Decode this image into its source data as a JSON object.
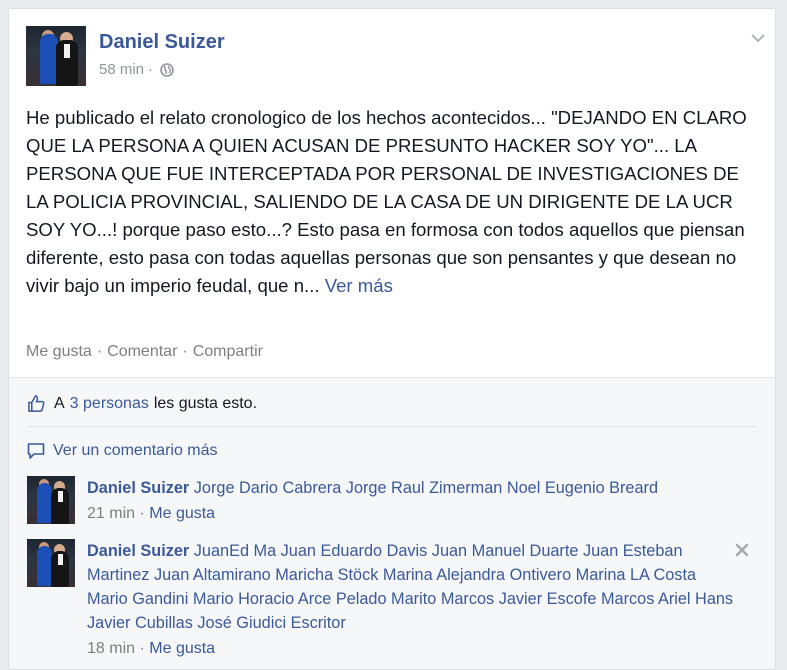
{
  "post": {
    "author": "Daniel Suizer",
    "time": "58 min",
    "separator": "·",
    "audience_icon": "globe-icon",
    "text": "He publicado el relato cronologico de los hechos acontecidos... \"DEJANDO EN CLARO QUE LA PERSONA A QUIEN ACUSAN DE PRESUNTO HACKER SOY YO\"... LA PERSONA QUE FUE INTERCEPTADA POR PERSONAL DE INVESTIGACIONES DE LA POLICIA PROVINCIAL, SALIENDO DE LA CASA DE UN DIRIGENTE DE LA UCR SOY YO...! porque paso esto...? Esto pasa en formosa con todos aquellos que piensan diferente, esto pasa con todas aquellas personas que son pensantes y que desean no vivir bajo un imperio feudal, que n...",
    "see_more": "Ver más"
  },
  "actions": {
    "like": "Me gusta",
    "comment": "Comentar",
    "share": "Compartir",
    "separator": "·"
  },
  "likes": {
    "prefix": "A",
    "people": "3 personas",
    "suffix": "les gusta esto."
  },
  "more_comments": "Ver un comentario más",
  "comments": [
    {
      "author": "Daniel Suizer",
      "text": "Jorge Dario Cabrera Jorge Raul Zimerman Noel Eugenio Breard",
      "time": "21 min",
      "like": "Me gusta"
    },
    {
      "author": "Daniel Suizer",
      "text": "JuanEd Ma Juan Eduardo Davis Juan Manuel Duarte Juan Esteban Martinez Juan Altamirano Maricha Stöck Marina Alejandra Ontivero Marina LA Costa Mario Gandini Mario Horacio Arce Pelado Marito Marcos Javier Escofe Marcos Ariel Hans Javier Cubillas José Giudici Escritor",
      "time": "18 min",
      "like": "Me gusta"
    }
  ],
  "colors": {
    "link_blue": "#3b5998",
    "text": "#141823",
    "muted": "#90949c",
    "footer_bg": "#f6f7f9"
  }
}
